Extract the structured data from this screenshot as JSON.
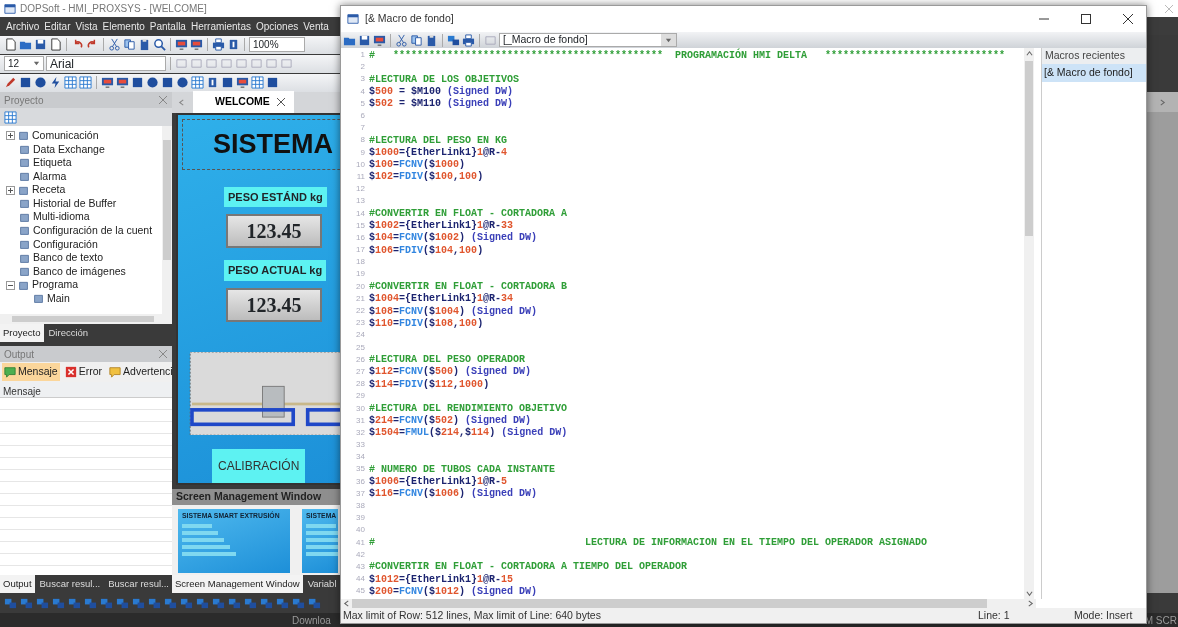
{
  "app": {
    "title": "DOPSoft - HMI_PROXSYS - [WELCOME]",
    "menu": [
      "Archivo",
      "Editar",
      "Vista",
      "Elemento",
      "Pantalla",
      "Herramientas",
      "Opciones",
      "Venta"
    ]
  },
  "toolbar": {
    "zoom": "100%",
    "font_size": "12",
    "font_name": "Arial"
  },
  "project_panel": {
    "title": "Proyecto",
    "tree": [
      {
        "label": "Comunicación",
        "expanded": false
      },
      {
        "label": "Data Exchange"
      },
      {
        "label": "Etiqueta"
      },
      {
        "label": "Alarma"
      },
      {
        "label": "Receta",
        "expanded": false
      },
      {
        "label": "Historial de Buffer"
      },
      {
        "label": "Multi-idioma"
      },
      {
        "label": "Configuración de la cuent"
      },
      {
        "label": "Configuración"
      },
      {
        "label": "Banco de texto"
      },
      {
        "label": "Banco de imágenes"
      },
      {
        "label": "Programa",
        "expanded": true,
        "children": [
          {
            "label": "Main"
          }
        ]
      }
    ],
    "tabs": [
      {
        "label": "Proyecto",
        "selected": true
      },
      {
        "label": "Dirección",
        "selected": false
      }
    ]
  },
  "output_panel": {
    "title": "Output",
    "filters": [
      {
        "label": "Mensaje",
        "kind": "message",
        "selected": true
      },
      {
        "label": "Error",
        "kind": "error",
        "selected": false
      },
      {
        "label": "Advertenci",
        "kind": "warning",
        "selected": false
      }
    ],
    "column": "Mensaje",
    "tabs": [
      {
        "label": "Output",
        "selected": true
      },
      {
        "label": "Buscar resul...",
        "selected": false
      },
      {
        "label": "Buscar resul...",
        "selected": false
      }
    ]
  },
  "editor_tabs": [
    {
      "label": "WELCOME",
      "selected": true
    }
  ],
  "hmi_screen": {
    "title": "SISTEMA",
    "fields": [
      {
        "label": "PESO ESTÁND kg",
        "value": "123.45"
      },
      {
        "label": "PESO ACTUAL kg",
        "value": "123.45"
      }
    ],
    "button": "CALIBRACIÓN"
  },
  "screen_manager": {
    "title": "Screen Management Window",
    "thumbnails": [
      {
        "title": "SISTEMA SMART EXTRUSIÓN"
      },
      {
        "title": "SISTEMA"
      }
    ],
    "tabs": [
      {
        "label": "Screen Management Window",
        "selected": true
      },
      {
        "label": "Variabl",
        "selected": false
      }
    ]
  },
  "status_bar": {
    "left": "Downloa",
    "right": "M SCR"
  },
  "macro_window": {
    "title": "[& Macro de fondo]",
    "macro_select": "[_Macro de fondo]",
    "lines": [
      {
        "n": "1",
        "kind": "comment",
        "text": "#   *********************************************  PROGRAMACIÓN HMI DELTA   ******************************"
      },
      {
        "n": "2",
        "kind": "blank"
      },
      {
        "n": "3",
        "kind": "comment",
        "text": "#LECTURA DE LOS OBJETIVOS"
      },
      {
        "n": "4",
        "kind": "code",
        "text": "$500 = $M100 (Signed DW)"
      },
      {
        "n": "5",
        "kind": "code",
        "text": "$502 = $M110 (Signed DW)"
      },
      {
        "n": "6",
        "kind": "blank"
      },
      {
        "n": "7",
        "kind": "blank"
      },
      {
        "n": "8",
        "kind": "comment",
        "text": "#LECTURA DEL PESO EN KG"
      },
      {
        "n": "9",
        "kind": "code",
        "text": "$1000={EtherLink1}1@R-4"
      },
      {
        "n": "10",
        "kind": "code",
        "text": "$100=FCNV($1000)"
      },
      {
        "n": "11",
        "kind": "code",
        "text": "$102=FDIV($100,100)"
      },
      {
        "n": "12",
        "kind": "blank"
      },
      {
        "n": "13",
        "kind": "blank"
      },
      {
        "n": "14",
        "kind": "comment",
        "text": "#CONVERTIR EN FLOAT - CORTADORA A"
      },
      {
        "n": "15",
        "kind": "code",
        "text": "$1002={EtherLink1}1@R-33"
      },
      {
        "n": "16",
        "kind": "code",
        "text": "$104=FCNV($1002) (Signed DW)"
      },
      {
        "n": "17",
        "kind": "code",
        "text": "$106=FDIV($104,100)"
      },
      {
        "n": "18",
        "kind": "blank"
      },
      {
        "n": "19",
        "kind": "blank"
      },
      {
        "n": "20",
        "kind": "comment",
        "text": "#CONVERTIR EN FLOAT - CORTADORA B"
      },
      {
        "n": "21",
        "kind": "code",
        "text": "$1004={EtherLink1}1@R-34"
      },
      {
        "n": "22",
        "kind": "code",
        "text": "$108=FCNV($1004) (Signed DW)"
      },
      {
        "n": "23",
        "kind": "code",
        "text": "$110=FDIV($108,100)"
      },
      {
        "n": "24",
        "kind": "blank"
      },
      {
        "n": "25",
        "kind": "blank"
      },
      {
        "n": "26",
        "kind": "comment",
        "text": "#LECTURA DEL PESO OPERADOR"
      },
      {
        "n": "27",
        "kind": "code",
        "text": "$112=FCNV($500) (Signed DW)"
      },
      {
        "n": "28",
        "kind": "code",
        "text": "$114=FDIV($112,1000)"
      },
      {
        "n": "29",
        "kind": "blank"
      },
      {
        "n": "30",
        "kind": "comment",
        "text": "#LECTURA DEL RENDIMIENTO OBJETIVO"
      },
      {
        "n": "31",
        "kind": "code",
        "text": "$214=FCNV($502) (Signed DW)"
      },
      {
        "n": "32",
        "kind": "code",
        "text": "$1504=FMUL($214,$114) (Signed DW)"
      },
      {
        "n": "33",
        "kind": "blank"
      },
      {
        "n": "34",
        "kind": "blank"
      },
      {
        "n": "35",
        "kind": "comment",
        "text": "# NUMERO DE TUBOS CADA INSTANTE"
      },
      {
        "n": "36",
        "kind": "code",
        "text": "$1006={EtherLink1}1@R-5"
      },
      {
        "n": "37",
        "kind": "code",
        "text": "$116=FCNV($1006) (Signed DW)"
      },
      {
        "n": "38",
        "kind": "blank"
      },
      {
        "n": "39",
        "kind": "blank"
      },
      {
        "n": "40",
        "kind": "blank"
      },
      {
        "n": "41",
        "kind": "comment",
        "text": "#                                   LECTURA DE INFORMACION EN EL TIEMPO DEL OPERADOR ASIGNADO"
      },
      {
        "n": "42",
        "kind": "blank"
      },
      {
        "n": "43",
        "kind": "comment",
        "text": "#CONVERTIR EN FLOAT - CORTADORA A TIEMPO DEL OPERADOR"
      },
      {
        "n": "44",
        "kind": "code",
        "text": "$1012={EtherLink1}1@R-15"
      },
      {
        "n": "45",
        "kind": "code",
        "text": "$200=FCNV($1012) (Signed DW)"
      }
    ],
    "recent": {
      "title": "Macros recientes",
      "items": [
        {
          "label": "[& Macro de fondo]",
          "selected": true
        }
      ]
    },
    "status": {
      "limits": "Max limit of Row: 512 lines, Max limit of Line: 640 bytes",
      "line": "Line: 1",
      "mode": "Mode: Insert"
    }
  }
}
